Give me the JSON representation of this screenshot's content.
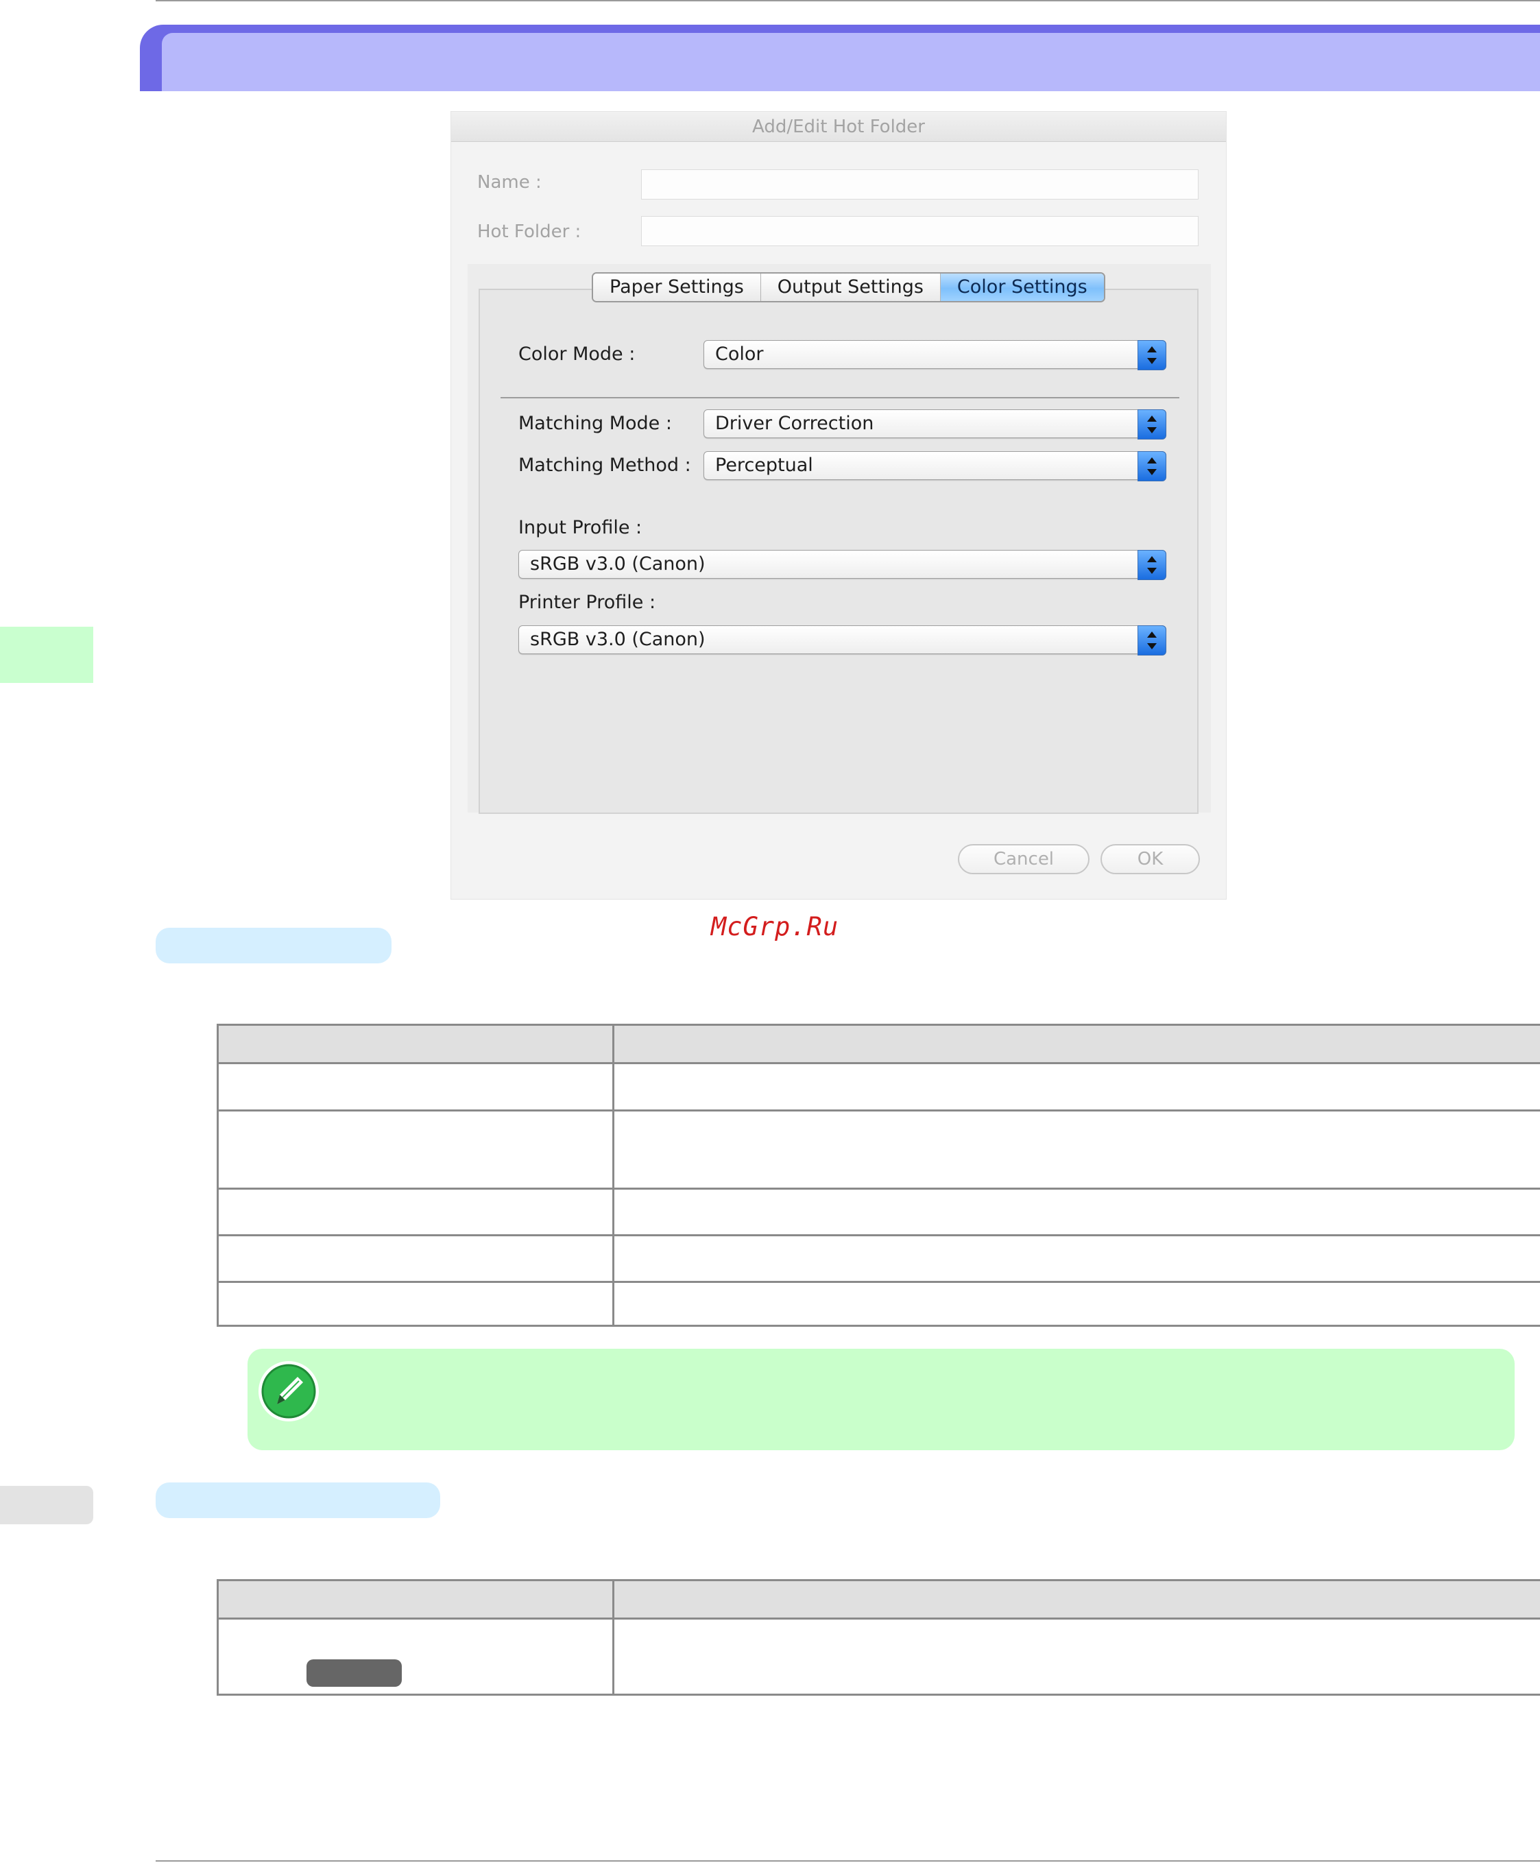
{
  "dialog": {
    "title": "Add/Edit Hot Folder",
    "name_label": "Name :",
    "name_value": "",
    "hot_folder_label": "Hot Folder :",
    "hot_folder_value": "",
    "tabs": [
      {
        "label": "Paper Settings",
        "selected": false
      },
      {
        "label": "Output Settings",
        "selected": false
      },
      {
        "label": "Color Settings",
        "selected": true
      }
    ],
    "color_mode": {
      "label": "Color Mode :",
      "value": "Color"
    },
    "matching_mode": {
      "label": "Matching Mode :",
      "value": "Driver Correction"
    },
    "matching_method": {
      "label": "Matching Method :",
      "value": "Perceptual"
    },
    "input_profile": {
      "label": "Input Profile :",
      "value": "sRGB v3.0 (Canon)"
    },
    "printer_profile": {
      "label": "Printer Profile :",
      "value": "sRGB v3.0 (Canon)"
    },
    "cancel_label": "Cancel",
    "ok_label": "OK"
  },
  "watermark": "McGrp.Ru",
  "icons": {
    "note": "pencil-note-icon"
  },
  "colors": {
    "title_bar": "#6e69e6",
    "title_bar_inner": "#b7b8fb",
    "section_pill": "#d5efff",
    "note_bg": "#c9ffcb",
    "tab_selected": "#7fc0fb",
    "stepper": "#1a6de0",
    "watermark": "#d31d1d"
  }
}
